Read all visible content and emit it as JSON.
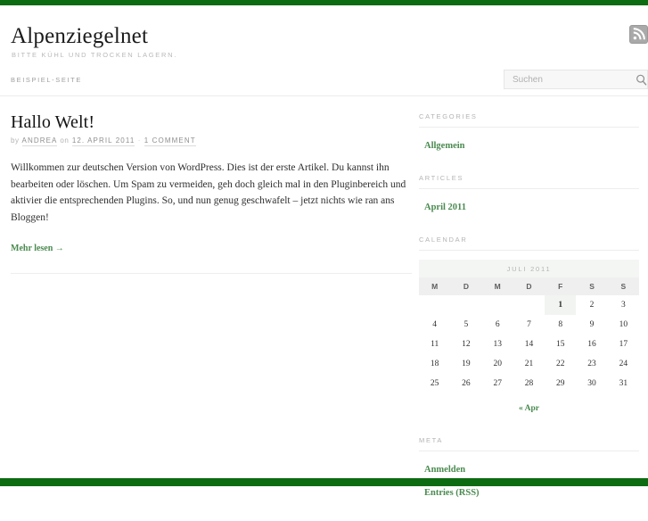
{
  "theme": {
    "accent_green": "#0d6b11",
    "link_green": "#4a8a4f",
    "muted_gray": "#b4b4b4"
  },
  "header": {
    "site_title": "Alpenziegelnet",
    "site_description": "Bitte kühl und trocken lagern.",
    "rss_icon": "rss-icon"
  },
  "nav": {
    "items": [
      {
        "label": "Beispiel-Seite"
      }
    ]
  },
  "search": {
    "placeholder": "Suchen",
    "value": "",
    "icon": "search-icon"
  },
  "post": {
    "title": "Hallo Welt!",
    "meta": {
      "by_label": "by",
      "author": "ANDREA",
      "on_label": "on",
      "date": "12. APRIL 2011",
      "separator": "·",
      "comments": "1 COMMENT"
    },
    "body": "Willkommen zur deutschen Version von WordPress. Dies ist der erste Artikel. Du kannst ihn bearbeiten oder löschen. Um Spam zu vermeiden, geh doch gleich mal in den Pluginbereich und aktivier die entsprechenden Plugins. So, und nun genug geschwafelt – jetzt nichts wie ran ans Bloggen!",
    "more_link": "Mehr lesen →"
  },
  "sidebar": {
    "categories": {
      "title": "Categories",
      "items": [
        {
          "label": "Allgemein"
        }
      ]
    },
    "articles": {
      "title": "Articles",
      "items": [
        {
          "label": "April 2011"
        }
      ]
    },
    "calendar": {
      "title": "Calendar",
      "caption": "Juli 2011",
      "weekdays": [
        "M",
        "D",
        "M",
        "D",
        "F",
        "S",
        "S"
      ],
      "weeks": [
        [
          "",
          "",
          "",
          "",
          "1",
          "2",
          "3"
        ],
        [
          "4",
          "5",
          "6",
          "7",
          "8",
          "9",
          "10"
        ],
        [
          "11",
          "12",
          "13",
          "14",
          "15",
          "16",
          "17"
        ],
        [
          "18",
          "19",
          "20",
          "21",
          "22",
          "23",
          "24"
        ],
        [
          "25",
          "26",
          "27",
          "28",
          "29",
          "30",
          "31"
        ]
      ],
      "today": "1",
      "prev_link": "« Apr"
    },
    "meta": {
      "title": "Meta",
      "items": [
        {
          "label": "Anmelden"
        },
        {
          "label": "Entries (RSS)"
        }
      ]
    }
  }
}
